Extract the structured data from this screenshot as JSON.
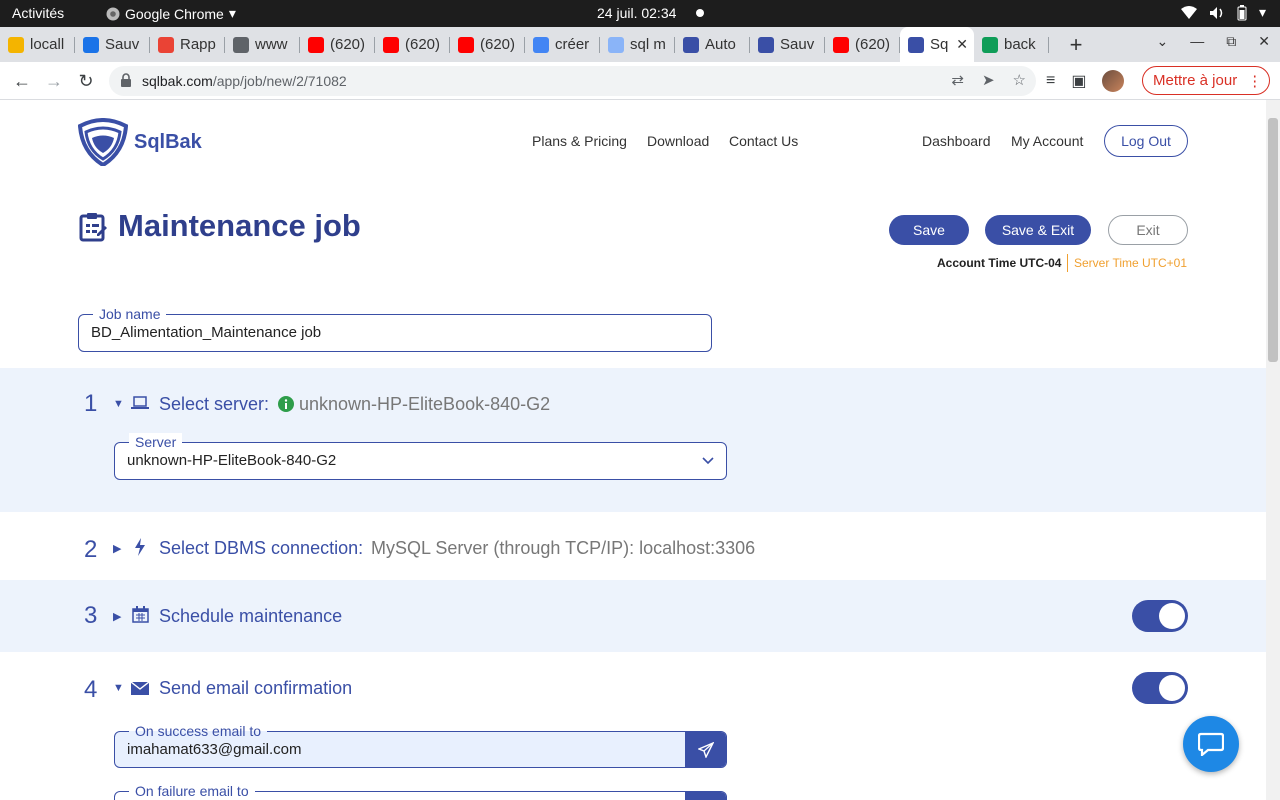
{
  "os_bar": {
    "activities": "Activités",
    "app_name": "Google Chrome",
    "clock": "24 juil.  02:34"
  },
  "tabs": [
    {
      "label": "locall",
      "color": "#f4b400"
    },
    {
      "label": "Sauv",
      "color": "#1a73e8"
    },
    {
      "label": "Rapp",
      "color": "#ea4335"
    },
    {
      "label": "www",
      "color": "#5f6368"
    },
    {
      "label": "(620)",
      "color": "#ff0000"
    },
    {
      "label": "(620)",
      "color": "#ff0000"
    },
    {
      "label": "(620)",
      "color": "#ff0000"
    },
    {
      "label": "créer",
      "color": "#4285f4"
    },
    {
      "label": "sql m",
      "color": "#8ab4f8"
    },
    {
      "label": "Auto",
      "color": "#3a4fa6"
    },
    {
      "label": "Sauv",
      "color": "#3a4fa6"
    },
    {
      "label": "(620)",
      "color": "#ff0000"
    },
    {
      "label": "Sq",
      "color": "#3a4fa6",
      "active": true
    },
    {
      "label": "back",
      "color": "#0f9d58"
    }
  ],
  "address": {
    "domain": "sqlbak.com",
    "path": "/app/job/new/2/71082",
    "update_label": "Mettre à jour"
  },
  "site": {
    "brand": "SqlBak",
    "nav": {
      "plans": "Plans & Pricing",
      "download": "Download",
      "contact": "Contact Us",
      "dashboard": "Dashboard",
      "account": "My Account",
      "logout": "Log Out"
    }
  },
  "job": {
    "title": "Maintenance job",
    "save": "Save",
    "save_exit": "Save & Exit",
    "exit": "Exit",
    "account_time": "Account Time UTC-04",
    "server_time": "Server Time UTC+01",
    "name_legend": "Job name",
    "name_value": "BD_Alimentation_Maintenance job"
  },
  "steps": {
    "s1": {
      "num": "1",
      "title": "Select server:",
      "detail": "unknown-HP-EliteBook-840-G2",
      "server_legend": "Server",
      "server_value": "unknown-HP-EliteBook-840-G2"
    },
    "s2": {
      "num": "2",
      "title": "Select DBMS connection:",
      "detail": "MySQL Server (through TCP/IP): localhost:3306"
    },
    "s3": {
      "num": "3",
      "title": "Schedule maintenance",
      "enabled": true
    },
    "s4": {
      "num": "4",
      "title": "Send email confirmation",
      "enabled": true,
      "success_legend": "On success email to",
      "success_value": "imahamat633@gmail.com",
      "failure_legend": "On failure email to"
    }
  },
  "colors": {
    "brand": "#3a4fa6",
    "section_bg": "#edf3fc",
    "server_time": "#f0a030",
    "chat": "#1e88e5"
  }
}
